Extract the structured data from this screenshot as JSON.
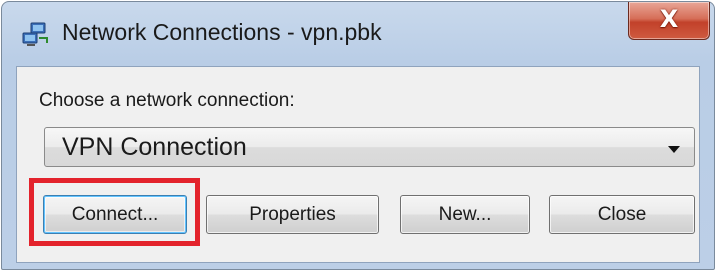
{
  "window": {
    "title": "Network Connections - vpn.pbk",
    "icon": "network-connections-icon",
    "close_glyph": "X"
  },
  "dialog": {
    "choose_label": "Choose a network connection:",
    "connection_select": {
      "value": "VPN Connection",
      "icon": "chevron-down-icon"
    },
    "buttons": {
      "connect": "Connect...",
      "properties": "Properties",
      "new": "New...",
      "close": "Close"
    }
  },
  "colors": {
    "highlight": "#e3232c",
    "close_button": "#c2412a",
    "focus_border": "#3c7fb1"
  }
}
